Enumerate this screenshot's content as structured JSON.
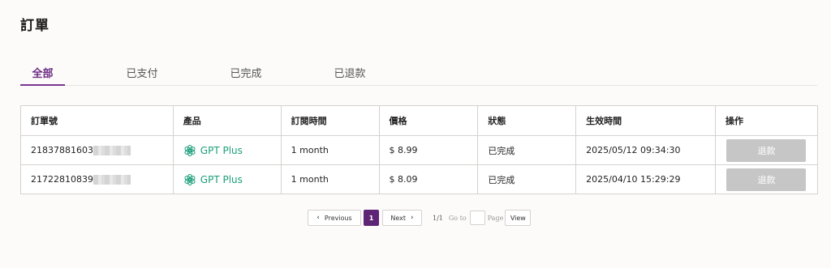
{
  "header": {
    "title": "訂單"
  },
  "tabs": [
    {
      "label": "全部"
    },
    {
      "label": "已支付"
    },
    {
      "label": "已完成"
    },
    {
      "label": "已退款"
    }
  ],
  "table": {
    "headers": [
      "訂單號",
      "產品",
      "訂閱時間",
      "價格",
      "狀態",
      "生效時間",
      "操作"
    ],
    "rows": [
      {
        "order_id": "21837881603",
        "product": "GPT Plus",
        "duration": "1 month",
        "price": "$ 8.99",
        "status": "已完成",
        "effective_time": "2025/05/12 09:34:30",
        "action": "退款"
      },
      {
        "order_id": "21722810839",
        "product": "GPT Plus",
        "duration": "1 month",
        "price": "$ 8.09",
        "status": "已完成",
        "effective_time": "2025/04/10 15:29:29",
        "action": "退款"
      }
    ]
  },
  "pagination": {
    "previous": "Previous",
    "current_page": "1",
    "next": "Next",
    "page_info": "1/1",
    "goto_label": "Go to",
    "page_label": "Page",
    "view_label": "View"
  },
  "colors": {
    "accent": "#7a3592",
    "product": "#1a9e7a",
    "disabled": "#c6c6c6"
  }
}
